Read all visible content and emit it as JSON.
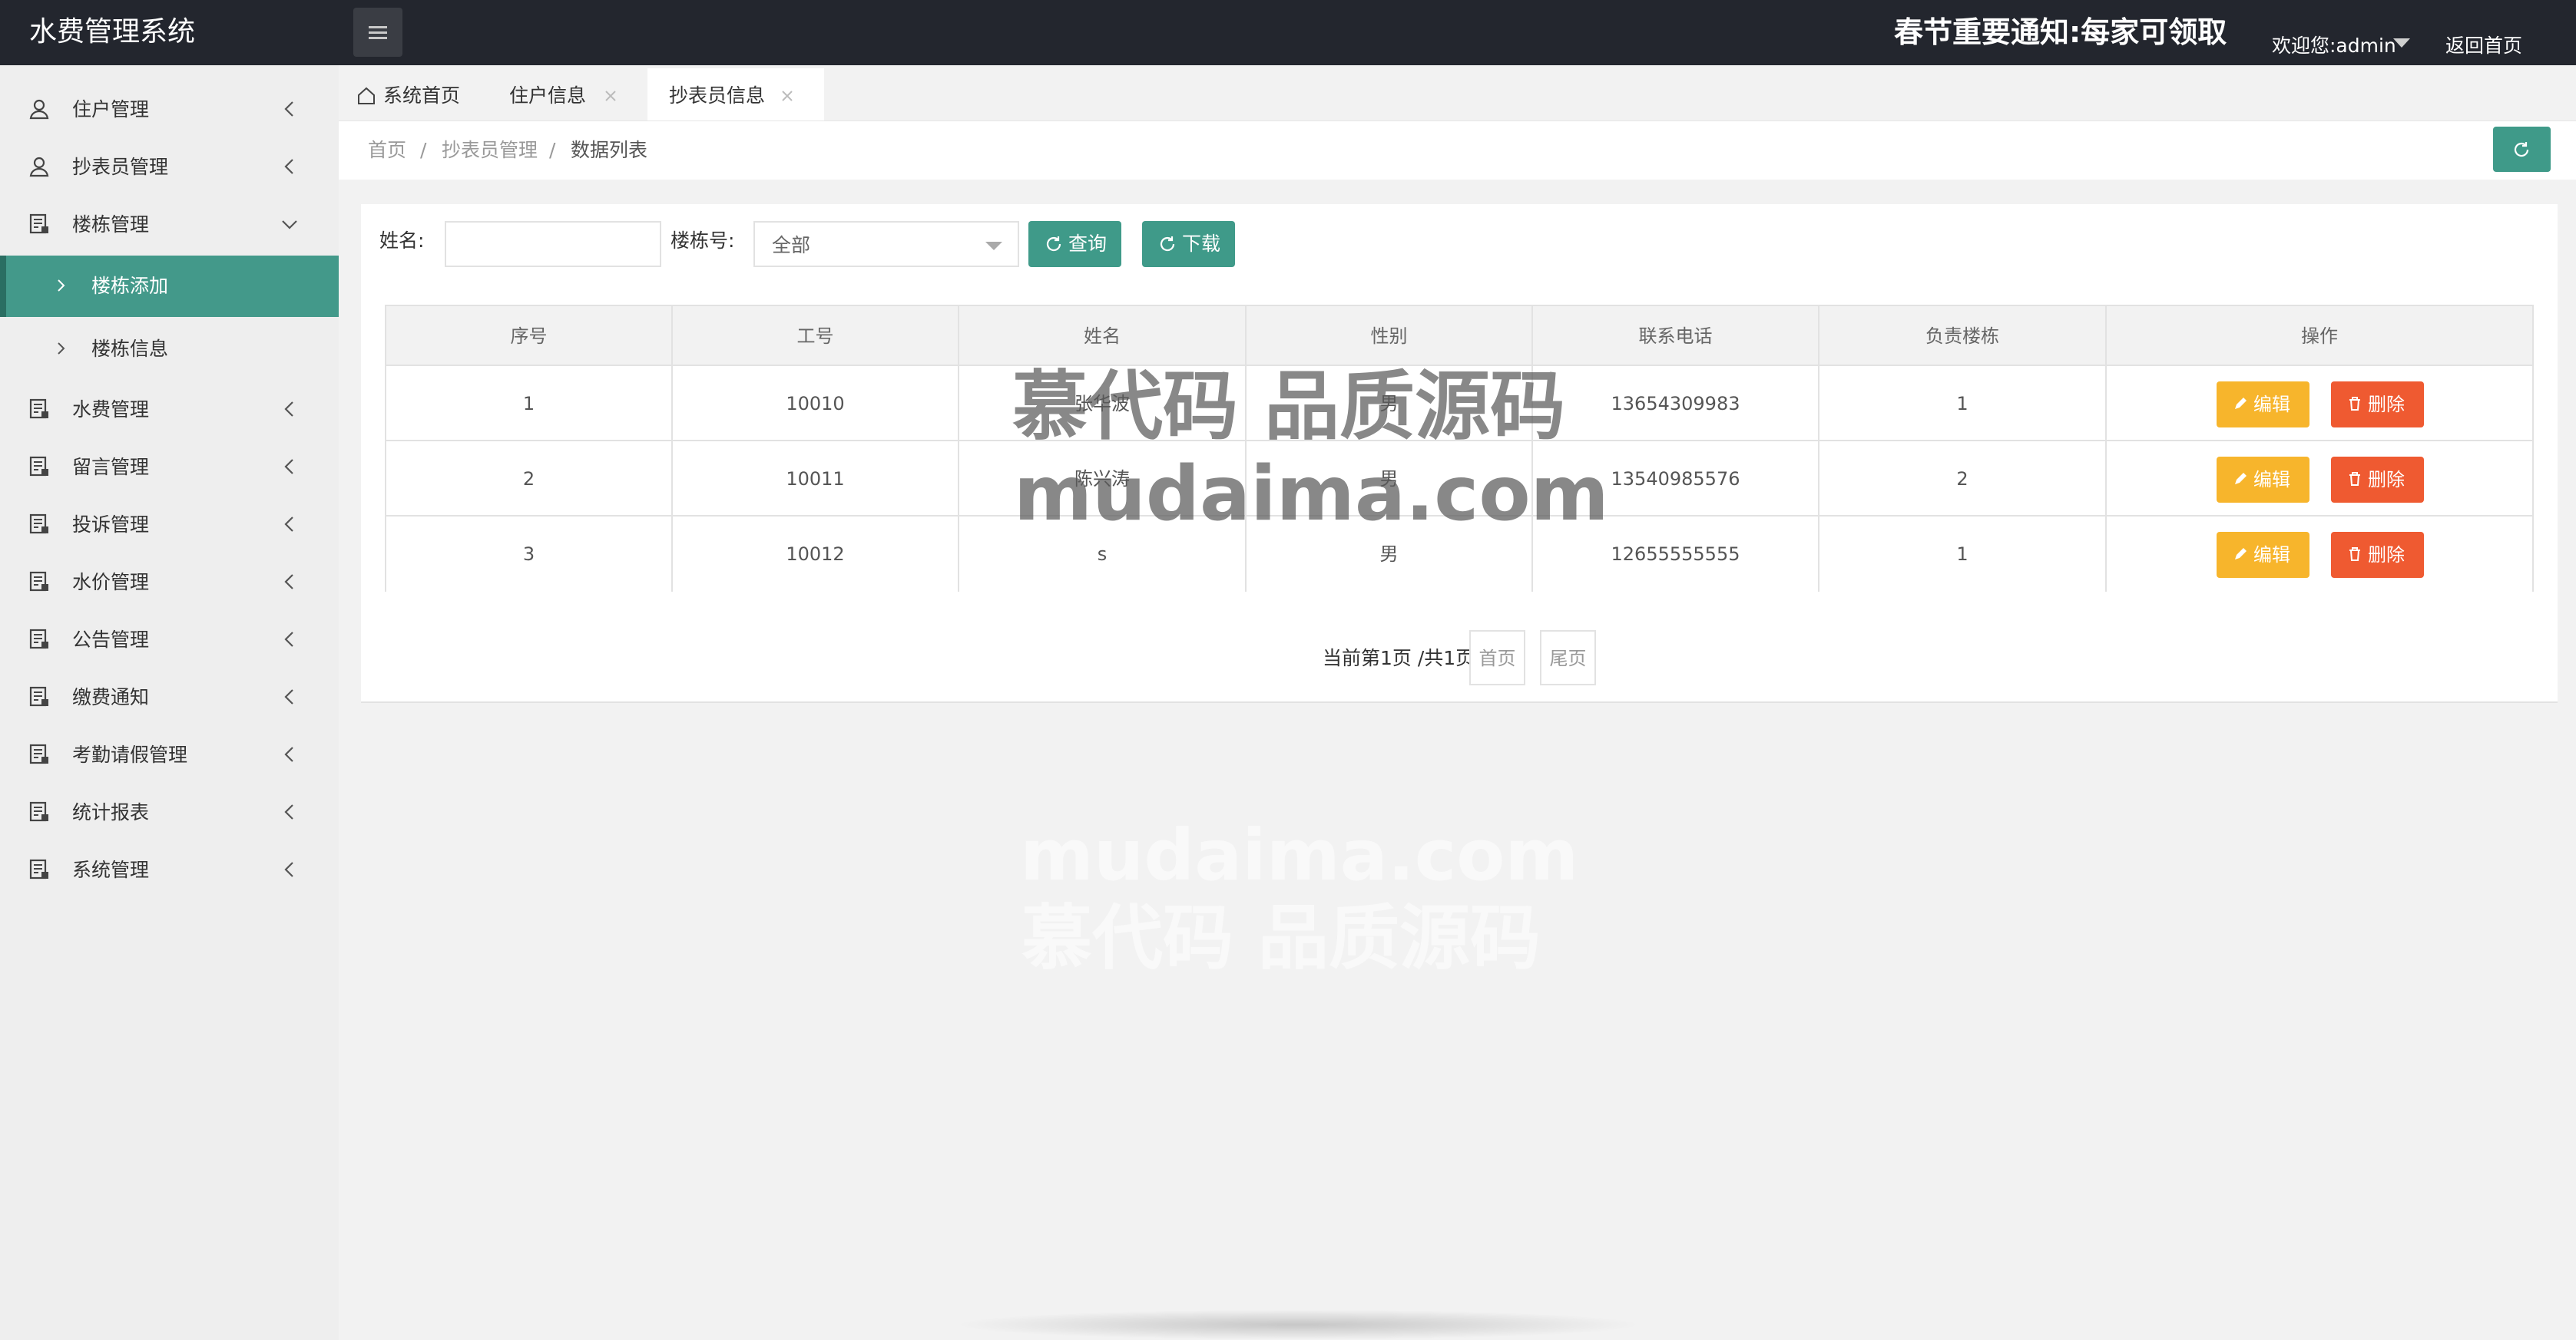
{
  "header": {
    "app_title": "水费管理系统",
    "notice": "春节重要通知:每家可领取",
    "welcome": "欢迎您:admin",
    "home_link": "返回首页"
  },
  "sidebar": {
    "items": [
      {
        "label": "住户管理",
        "icon": "user-icon"
      },
      {
        "label": "抄表员管理",
        "icon": "user-icon"
      },
      {
        "label": "楼栋管理",
        "icon": "form-icon",
        "expanded": true
      },
      {
        "label": "水费管理",
        "icon": "form-icon"
      },
      {
        "label": "留言管理",
        "icon": "form-icon"
      },
      {
        "label": "投诉管理",
        "icon": "form-icon"
      },
      {
        "label": "水价管理",
        "icon": "form-icon"
      },
      {
        "label": "公告管理",
        "icon": "form-icon"
      },
      {
        "label": "缴费通知",
        "icon": "form-icon"
      },
      {
        "label": "考勤请假管理",
        "icon": "form-icon"
      },
      {
        "label": "统计报表",
        "icon": "form-icon"
      },
      {
        "label": "系统管理",
        "icon": "form-icon"
      }
    ],
    "subitems": [
      {
        "label": "楼栋添加",
        "active": true
      },
      {
        "label": "楼栋信息",
        "active": false
      }
    ]
  },
  "tabs": [
    {
      "label": "系统首页",
      "closable": false
    },
    {
      "label": "住户信息",
      "closable": true
    },
    {
      "label": "抄表员信息",
      "closable": true,
      "active": true
    }
  ],
  "breadcrumb": [
    "首页",
    "/",
    "抄表员管理",
    "/",
    "数据列表"
  ],
  "filter": {
    "name_label": "姓名:",
    "name_value": "",
    "building_label": "楼栋号:",
    "building_selected": "全部",
    "query_label": "查询",
    "download_label": "下载"
  },
  "table": {
    "columns": [
      "序号",
      "工号",
      "姓名",
      "性别",
      "联系电话",
      "负责楼栋",
      "操作"
    ],
    "rows": [
      [
        "1",
        "10010",
        "张华波",
        "男",
        "13654309983",
        "1"
      ],
      [
        "2",
        "10011",
        "陈兴涛",
        "男",
        "13540985576",
        "2"
      ],
      [
        "3",
        "10012",
        "s",
        "男",
        "12655555555",
        "1"
      ]
    ],
    "edit_label": "编辑",
    "delete_label": "删除"
  },
  "pager": {
    "info": "当前第1页 /共1页",
    "first_label": "首页",
    "last_label": "尾页"
  },
  "watermark": {
    "line1": "慕代码 品质源码",
    "line2": "mudaima.com"
  },
  "colors": {
    "topbar": "#23262e",
    "accent": "#43998a",
    "edit": "#f7b52c",
    "delete": "#ef5a31"
  }
}
